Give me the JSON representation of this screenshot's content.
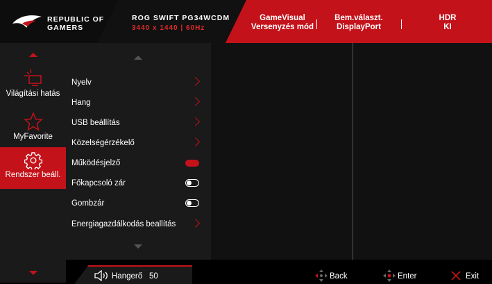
{
  "header": {
    "brand": [
      "REPUBLIC OF",
      "GAMERS"
    ],
    "model": "ROG SWIFT PG34WCDM",
    "resolution": "3440 x 1440  |  60Hz",
    "gamevisual_title": "GameVisual",
    "gamevisual_value": "Versenyzés mód",
    "input_title": "Bem.választ.",
    "input_value": "DisplayPort",
    "hdr_title": "HDR",
    "hdr_value": "KI"
  },
  "sidebar": {
    "items": [
      {
        "label": "Világítási hatás",
        "icon": "light-effect-icon"
      },
      {
        "label": "MyFavorite",
        "icon": "star-icon"
      },
      {
        "label": "Rendszer beáll.",
        "icon": "gear-icon",
        "active": true
      }
    ]
  },
  "submenu": {
    "items": [
      {
        "label": "Nyelv",
        "control": "chevron"
      },
      {
        "label": "Hang",
        "control": "chevron"
      },
      {
        "label": "USB beállítás",
        "control": "chevron"
      },
      {
        "label": "Közelségérzékelő",
        "control": "chevron"
      },
      {
        "label": "Működésjelző",
        "control": "toggle-on"
      },
      {
        "label": "Főkapcsoló zár",
        "control": "toggle-off"
      },
      {
        "label": "Gombzár",
        "control": "toggle-off"
      },
      {
        "label": "Energiagazdálkodás beallítás",
        "control": "chevron"
      }
    ]
  },
  "bottom": {
    "volume_label": "Hangerő",
    "volume_value": "50",
    "back_label": "Back",
    "enter_label": "Enter",
    "exit_label": "Exit"
  },
  "colors": {
    "accent": "#c4121a",
    "panel": "#1a1a1a",
    "background": "#000000"
  }
}
